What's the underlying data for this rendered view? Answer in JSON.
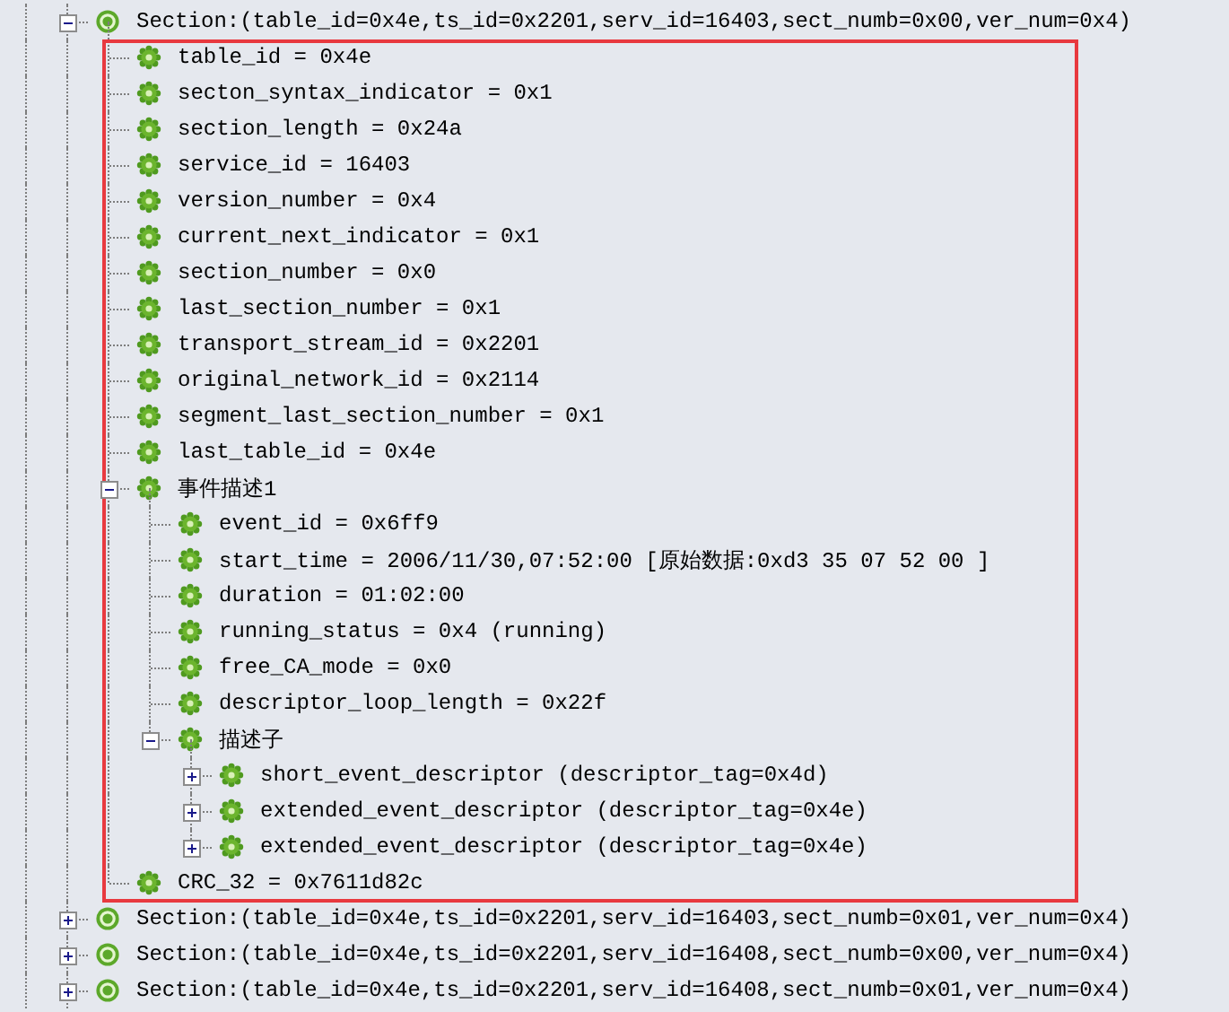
{
  "tree": [
    {
      "kind": "section",
      "label": "Section:(table_id=0x4e,ts_id=0x2201,serv_id=16403,sect_numb=0x00,ver_num=0x4)",
      "expanded": true,
      "children": [
        {
          "kind": "field",
          "label": "table_id = 0x4e"
        },
        {
          "kind": "field",
          "label": "secton_syntax_indicator = 0x1"
        },
        {
          "kind": "field",
          "label": "section_length = 0x24a"
        },
        {
          "kind": "field",
          "label": "service_id = 16403"
        },
        {
          "kind": "field",
          "label": "version_number = 0x4"
        },
        {
          "kind": "field",
          "label": "current_next_indicator = 0x1"
        },
        {
          "kind": "field",
          "label": "section_number = 0x0"
        },
        {
          "kind": "field",
          "label": "last_section_number = 0x1"
        },
        {
          "kind": "field",
          "label": "transport_stream_id = 0x2201"
        },
        {
          "kind": "field",
          "label": "original_network_id = 0x2114"
        },
        {
          "kind": "field",
          "label": "segment_last_section_number = 0x1"
        },
        {
          "kind": "field",
          "label": "last_table_id = 0x4e"
        },
        {
          "kind": "field",
          "label": "事件描述1",
          "expanded": true,
          "children": [
            {
              "kind": "field",
              "label": "event_id = 0x6ff9"
            },
            {
              "kind": "field",
              "label": "start_time = 2006/11/30,07:52:00 [原始数据:0xd3 35 07 52 00 ]"
            },
            {
              "kind": "field",
              "label": "duration = 01:02:00"
            },
            {
              "kind": "field",
              "label": "running_status = 0x4 (running)"
            },
            {
              "kind": "field",
              "label": "free_CA_mode = 0x0"
            },
            {
              "kind": "field",
              "label": "descriptor_loop_length = 0x22f"
            },
            {
              "kind": "field",
              "label": "描述子",
              "expanded": true,
              "children": [
                {
                  "kind": "field",
                  "label": "short_event_descriptor (descriptor_tag=0x4d)",
                  "expanded": false
                },
                {
                  "kind": "field",
                  "label": "extended_event_descriptor (descriptor_tag=0x4e)",
                  "expanded": false
                },
                {
                  "kind": "field",
                  "label": "extended_event_descriptor (descriptor_tag=0x4e)",
                  "expanded": false
                }
              ]
            }
          ]
        },
        {
          "kind": "field",
          "label": "CRC_32 = 0x7611d82c"
        }
      ]
    },
    {
      "kind": "section",
      "label": "Section:(table_id=0x4e,ts_id=0x2201,serv_id=16403,sect_numb=0x01,ver_num=0x4)",
      "expanded": false
    },
    {
      "kind": "section",
      "label": "Section:(table_id=0x4e,ts_id=0x2201,serv_id=16408,sect_numb=0x00,ver_num=0x4)",
      "expanded": false
    },
    {
      "kind": "section",
      "label": "Section:(table_id=0x4e,ts_id=0x2201,serv_id=16408,sect_numb=0x01,ver_num=0x4)",
      "expanded": false
    }
  ]
}
